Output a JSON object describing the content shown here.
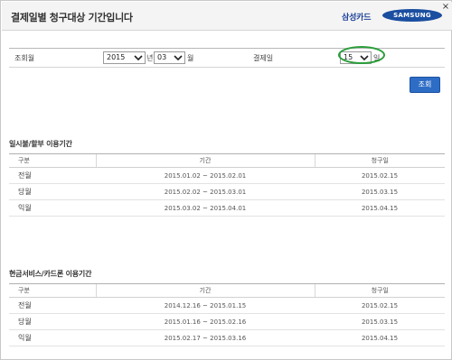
{
  "header": {
    "title": "결제일별 청구대상 기간입니다",
    "brand_kr": "삼성카드",
    "brand_logo": "SAMSUNG",
    "close_label": "×"
  },
  "search": {
    "period_label": "조회월",
    "year_value": "2015",
    "year_unit": "년",
    "month_value": "03",
    "month_unit": "월",
    "payday_label": "결제일",
    "payday_value": "15",
    "payday_unit": "일",
    "search_button": "조회"
  },
  "sections": [
    {
      "title": "일시불/할부 이용기간",
      "headers": [
        "구분",
        "기간",
        "청구일"
      ],
      "rows": [
        {
          "gubun": "전월",
          "period": "2015.01.02 ~ 2015.02.01",
          "bill_date": "2015.02.15"
        },
        {
          "gubun": "당월",
          "period": "2015.02.02 ~ 2015.03.01",
          "bill_date": "2015.03.15"
        },
        {
          "gubun": "익월",
          "period": "2015.03.02 ~ 2015.04.01",
          "bill_date": "2015.04.15"
        }
      ]
    },
    {
      "title": "현금서비스/카드론 이용기간",
      "headers": [
        "구분",
        "기간",
        "청구일"
      ],
      "rows": [
        {
          "gubun": "전월",
          "period": "2014.12.16 ~ 2015.01.15",
          "bill_date": "2015.02.15"
        },
        {
          "gubun": "당월",
          "period": "2015.01.16 ~ 2015.02.16",
          "bill_date": "2015.03.15"
        },
        {
          "gubun": "익월",
          "period": "2015.02.17 ~ 2015.03.16",
          "bill_date": "2015.04.15"
        }
      ]
    }
  ],
  "colors": {
    "accent_button": "#2e6dc6",
    "brand_blue": "#1b3f97",
    "highlight_ring": "#2a9e3a"
  }
}
